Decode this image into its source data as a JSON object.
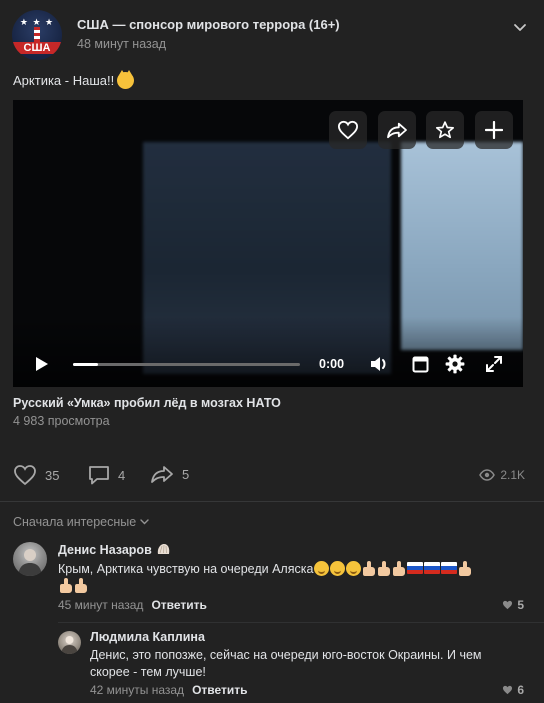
{
  "post": {
    "group_name": "США — спонсор мирового террора (16+)",
    "avatar_text": "США",
    "avatar_stars": "★ ★ ★",
    "time": "48 минут назад",
    "text": "Арктика - Наша!!",
    "text_emoji": "cat-face-emoji"
  },
  "video": {
    "time": "0:00",
    "progress": 0.11,
    "title": "Русский «Умка» пробил лёд в мозгах НАТО",
    "views": "4 983 просмотра",
    "overlay_buttons": [
      "like-icon",
      "share-icon",
      "bookmark-star-icon",
      "add-plus-icon"
    ],
    "control_icons": [
      "play-icon",
      "volume-icon",
      "pip-window-icon",
      "settings-gear-icon",
      "fullscreen-icon"
    ]
  },
  "actions": {
    "likes": "35",
    "comments": "4",
    "shares": "5",
    "views": "2.1K"
  },
  "comments_sort": {
    "label": "Сначала интересные"
  },
  "comments": [
    {
      "author": "Денис Назаров",
      "author_badge": "shell-emoji",
      "text": "Крым, Арктика чувствую на очереди Аляска",
      "text_emojis": [
        "wink",
        "wink",
        "wink",
        "thumbs-up",
        "thumbs-up",
        "thumbs-up",
        "flag-ru",
        "flag-ru",
        "flag-ru",
        "thumbs-up",
        "thumbs-up",
        "thumbs-up"
      ],
      "time": "45 минут назад",
      "reply_label": "Ответить",
      "likes": "5"
    },
    {
      "author": "Людмила Каплина",
      "text_line1": "Денис, это попозже, сейчас на очереди юго-восток Окраины. И чем",
      "text_line2": "скорее - тем лучше!",
      "time": "42 минуты назад",
      "reply_label": "Ответить",
      "likes": "6"
    }
  ],
  "colors": {
    "background": "#222222",
    "text": "#e1e3e6",
    "secondary_text": "#939393",
    "divider": "#363738"
  }
}
